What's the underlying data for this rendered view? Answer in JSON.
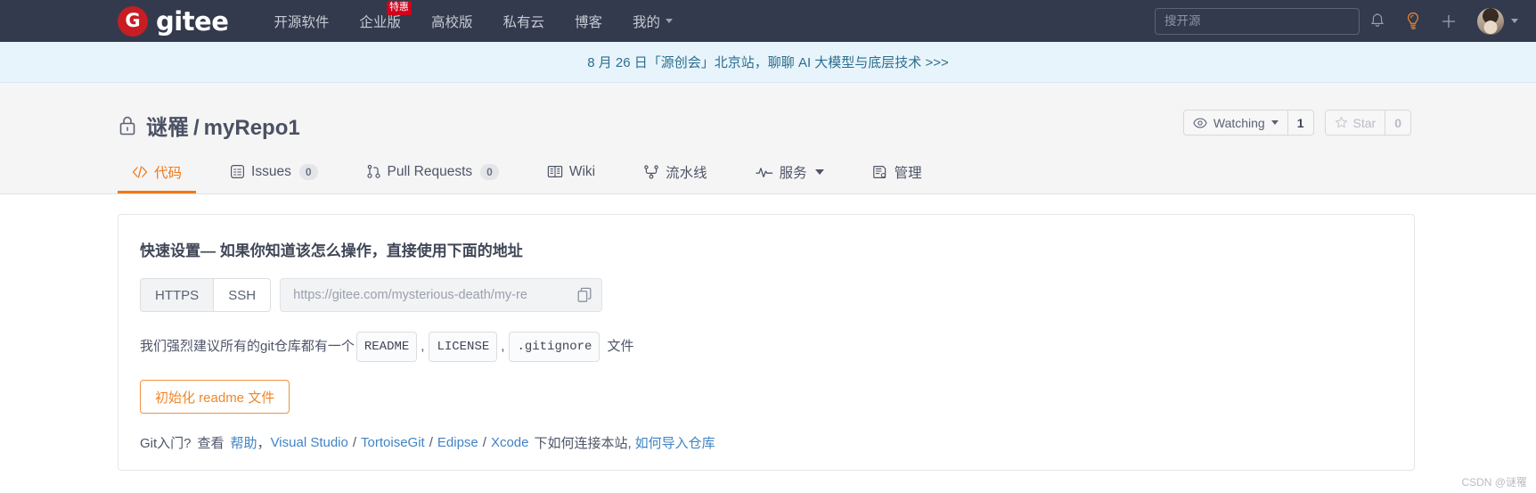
{
  "header": {
    "logo_text": "gitee",
    "logo_mark": "G",
    "nav": [
      {
        "label": "开源软件",
        "badge": ""
      },
      {
        "label": "企业版",
        "badge": "特惠"
      },
      {
        "label": "高校版",
        "badge": ""
      },
      {
        "label": "私有云",
        "badge": ""
      },
      {
        "label": "博客",
        "badge": ""
      },
      {
        "label": "我的",
        "badge": "",
        "has_caret": true
      }
    ],
    "search_placeholder": "搜开源",
    "icons": [
      "bell-icon",
      "lightbulb-icon",
      "plus-icon"
    ],
    "accent_color": "#c71d23",
    "lightbulb_color": "#f0872a",
    "background_color": "#333a4d"
  },
  "announcement": {
    "text": "8 月 26 日「源创会」北京站，聊聊 AI 大模型与底层技术 >>>",
    "color": "#2b6e8f",
    "background_color": "#e8f4fb"
  },
  "repo": {
    "visibility_icon": "lock-icon",
    "owner": "谜罹",
    "separator": "/",
    "name": "myRepo1",
    "watch": {
      "label": "Watching",
      "count": "1"
    },
    "star": {
      "label": "Star",
      "count": "0"
    }
  },
  "tabs": [
    {
      "label": "代码",
      "icon": "code-icon",
      "count": "",
      "active": true
    },
    {
      "label": "Issues",
      "icon": "issue-icon",
      "count": "0",
      "active": false
    },
    {
      "label": "Pull Requests",
      "icon": "pull-request-icon",
      "count": "0",
      "active": false
    },
    {
      "label": "Wiki",
      "icon": "book-icon",
      "count": "",
      "active": false
    },
    {
      "label": "流水线",
      "icon": "pipeline-icon",
      "count": "",
      "active": false
    },
    {
      "label": "服务",
      "icon": "pulse-icon",
      "count": "",
      "active": false,
      "has_caret": true
    },
    {
      "label": "管理",
      "icon": "settings-icon",
      "count": "",
      "active": false
    }
  ],
  "quick_setup": {
    "title": "快速设置— 如果你知道该怎么操作，直接使用下面的地址",
    "protocols": [
      {
        "label": "HTTPS",
        "selected": true
      },
      {
        "label": "SSH",
        "selected": false
      }
    ],
    "clone_url": "https://gitee.com/mysterious-death/my-re",
    "copy_icon": "copy-icon",
    "advice_prefix": "我们强烈建议所有的git仓库都有一个",
    "advice_tags": [
      "README",
      "LICENSE",
      ".gitignore"
    ],
    "advice_suffix": "文件",
    "init_button": "初始化 readme 文件"
  },
  "help": {
    "prefix": "Git入门?",
    "view": "查看",
    "help_link": "帮助",
    "comma": "，",
    "ide_links": [
      "Visual Studio",
      "TortoiseGit",
      "Edipse",
      "Xcode"
    ],
    "middle_text": "下如何连接本站,",
    "import_link": "如何导入仓库"
  },
  "watermark": "CSDN @谜罹"
}
